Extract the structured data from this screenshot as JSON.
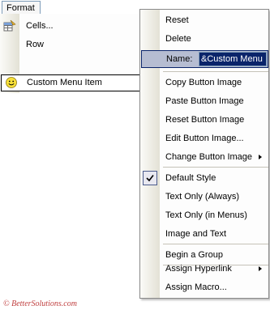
{
  "menubar": {
    "format_label": "Format"
  },
  "format_menu": {
    "items": [
      {
        "label": "Cells...",
        "icon": "cells-format-icon"
      },
      {
        "label": "Row",
        "icon": ""
      },
      {
        "label": "Custom Menu Item",
        "icon": "smiley-icon"
      }
    ]
  },
  "context_menu": {
    "reset": "Reset",
    "delete": "Delete",
    "name_label": "Name:",
    "name_value": "&Custom Menu It",
    "copy_image": "Copy Button Image",
    "paste_image": "Paste Button Image",
    "reset_image": "Reset Button Image",
    "edit_image": "Edit Button Image...",
    "change_image": "Change Button Image",
    "default_style": "Default Style",
    "text_only_always": "Text Only (Always)",
    "text_only_menus": "Text Only (in Menus)",
    "image_and_text": "Image and Text",
    "begin_group": "Begin a Group",
    "assign_hyperlink": "Assign Hyperlink",
    "assign_macro": "Assign Macro..."
  },
  "watermark": "© BetterSolutions.com",
  "colors": {
    "highlight": "#b6bdd2",
    "selection": "#0a246a",
    "watermark": "#c04040"
  }
}
